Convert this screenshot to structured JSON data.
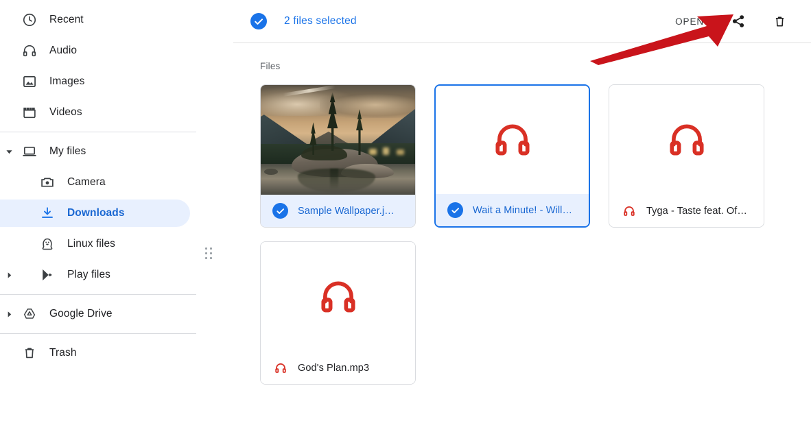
{
  "sidebar": {
    "groups": [
      {
        "items": [
          {
            "label": "Recent",
            "icon": "clock-icon",
            "selected": false
          },
          {
            "label": "Audio",
            "icon": "headphones-icon",
            "selected": false
          },
          {
            "label": "Images",
            "icon": "image-icon",
            "selected": false
          },
          {
            "label": "Videos",
            "icon": "video-icon",
            "selected": false
          }
        ]
      },
      {
        "items": [
          {
            "label": "My files",
            "icon": "laptop-icon",
            "selected": false,
            "expanded": true
          },
          {
            "label": "Camera",
            "icon": "camera-icon",
            "selected": false
          },
          {
            "label": "Downloads",
            "icon": "download-icon",
            "selected": true
          },
          {
            "label": "Linux files",
            "icon": "linux-penguin-icon",
            "selected": false
          },
          {
            "label": "Play files",
            "icon": "google-play-icon",
            "selected": false,
            "collapsed": true
          }
        ]
      },
      {
        "items": [
          {
            "label": "Google Drive",
            "icon": "google-drive-icon",
            "selected": false,
            "collapsed": true
          }
        ]
      },
      {
        "items": [
          {
            "label": "Trash",
            "icon": "trash-icon",
            "selected": false
          }
        ]
      }
    ],
    "drag_handle": "drag-handle-dots"
  },
  "toolbar": {
    "selection_label": "2 files selected",
    "selection_check_icon": "check-circle-icon",
    "open_label": "OPEN",
    "share_icon": "share-icon",
    "delete_icon": "trash-icon"
  },
  "main": {
    "section_title": "Files",
    "files": [
      {
        "name": "Sample Wallpaper.j…",
        "type": "image",
        "thumb": "landscape-photo",
        "selected": true,
        "focused": false,
        "badge_icon": "check-circle-icon"
      },
      {
        "name": "Wait a Minute! - Will…",
        "type": "audio",
        "thumb": "headphones-icon",
        "selected": true,
        "focused": true,
        "badge_icon": "check-circle-icon"
      },
      {
        "name": "Tyga - Taste feat. Of…",
        "type": "audio",
        "thumb": "headphones-icon",
        "selected": false,
        "focused": false,
        "badge_icon": "headphones-icon"
      },
      {
        "name": "God's Plan.mp3",
        "type": "audio",
        "thumb": "headphones-icon",
        "selected": false,
        "focused": false,
        "badge_icon": "headphones-icon"
      }
    ]
  },
  "annotation": {
    "arrow": "red-arrow-pointing-to-share-icon",
    "color": "#c9141b"
  },
  "colors": {
    "accent": "#1a73e8",
    "accent_text": "#1967d2",
    "selection_bg": "#e8f0fe",
    "audio_red": "#d93025",
    "text_primary": "#202124",
    "text_secondary": "#5f6368",
    "border": "#dadce0",
    "arrow_red": "#c9141b"
  }
}
